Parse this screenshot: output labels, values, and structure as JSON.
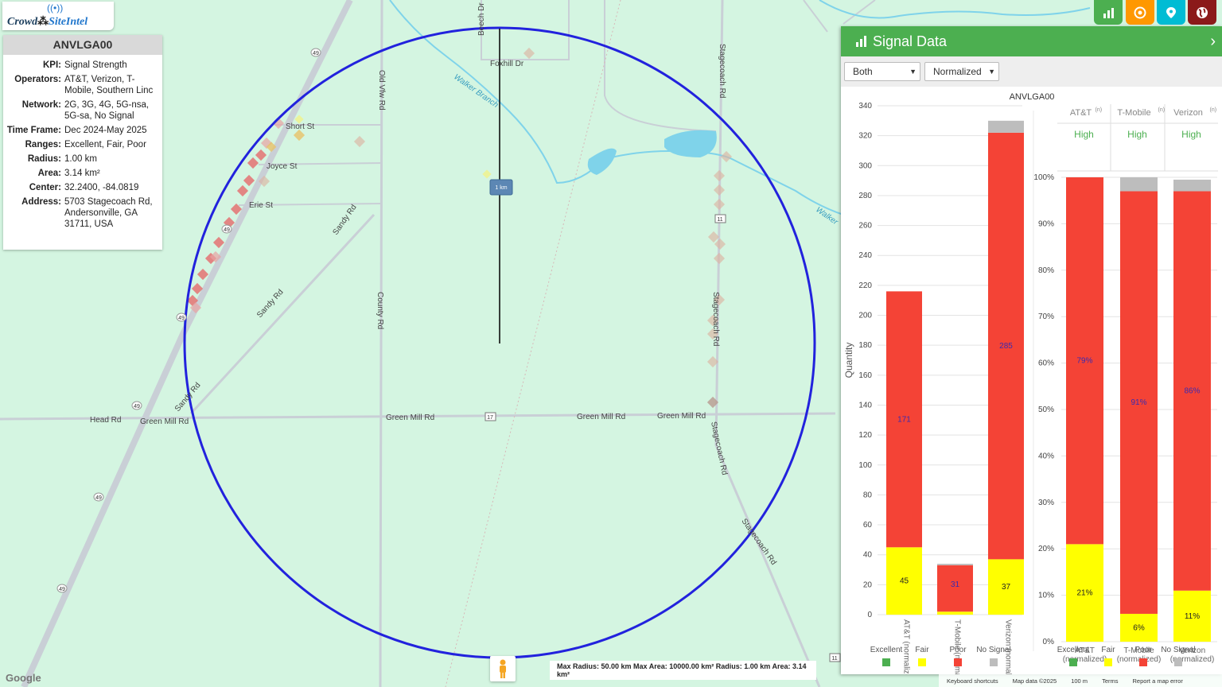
{
  "logo": {
    "part1": "Crowd",
    "part2": "SiteIntel"
  },
  "info": {
    "title": "ANVLGA00",
    "rows": [
      {
        "k": "KPI:",
        "v": "Signal Strength"
      },
      {
        "k": "Operators:",
        "v": "AT&T, Verizon, T-Mobile, Southern Linc"
      },
      {
        "k": "Network:",
        "v": "2G, 3G, 4G, 5G-nsa, 5G-sa, No Signal"
      },
      {
        "k": "Time Frame:",
        "v": "Dec 2024-May 2025"
      },
      {
        "k": "Ranges:",
        "v": "Excellent, Fair, Poor"
      },
      {
        "k": "Radius:",
        "v": "1.00 km"
      },
      {
        "k": "Area:",
        "v": "3.14 km²"
      },
      {
        "k": "Center:",
        "v": "32.2400, -84.0819"
      },
      {
        "k": "Address:",
        "v": "5703 Stagecoach Rd, Andersonville, GA 31711, USA"
      }
    ]
  },
  "toolbar": {
    "buttons": [
      {
        "icon": "bar-chart-icon",
        "color": "#4caf50"
      },
      {
        "icon": "target-icon",
        "color": "#ff9800"
      },
      {
        "icon": "map-pin-icon",
        "color": "#00bcd4"
      },
      {
        "icon": "globe-icon",
        "color": "#8b1a1a"
      }
    ]
  },
  "map": {
    "scale_label": "1 km",
    "road_labels": [
      "Beech Dr",
      "Foxhill Dr",
      "Walker Branch",
      "Old Vfw Rd",
      "Stagecoach Rd",
      "Short St",
      "Joyce St",
      "Erie St",
      "Sandy Rd",
      "County Rd",
      "Head Rd",
      "Green Mill Rd",
      "Walker"
    ],
    "shields": [
      "49",
      "11",
      "17"
    ]
  },
  "panel": {
    "title": "Signal Data",
    "select1": "Both",
    "select2": "Normalized",
    "chart_title": "ANVLGA00"
  },
  "chart_data": [
    {
      "type": "bar",
      "title": "ANVLGA00",
      "ylabel": "Quantity",
      "ylim": [
        0,
        340
      ],
      "yticks": [
        0,
        20,
        40,
        60,
        80,
        100,
        120,
        140,
        160,
        180,
        200,
        220,
        240,
        260,
        280,
        300,
        320,
        340
      ],
      "categories": [
        "AT&T (normalized)",
        "T-Mobile (normalized)",
        "Verizon (normalized)"
      ],
      "series": [
        {
          "name": "Excellent",
          "color": "#4caf50",
          "values": [
            0,
            0,
            0
          ]
        },
        {
          "name": "Fair",
          "color": "#ffff00",
          "values": [
            45,
            2,
            37
          ]
        },
        {
          "name": "Poor",
          "color": "#f44336",
          "values": [
            171,
            31,
            285
          ]
        },
        {
          "name": "No Signal",
          "color": "#bdbdbd",
          "values": [
            0,
            1,
            8
          ]
        }
      ],
      "value_labels": {
        "Fair": [
          "45",
          "2",
          "37"
        ],
        "Poor": [
          "171",
          "31",
          "285"
        ]
      },
      "legend": "bottom"
    },
    {
      "type": "bar",
      "stacked_percent": true,
      "ylim": [
        0,
        100
      ],
      "yticks": [
        "0%",
        "10%",
        "20%",
        "30%",
        "40%",
        "50%",
        "60%",
        "70%",
        "80%",
        "90%",
        "100%"
      ],
      "columns": [
        {
          "header": "AT&T",
          "sup": "(n)",
          "rating": "High"
        },
        {
          "header": "T-Mobile",
          "sup": "(n)",
          "rating": "High"
        },
        {
          "header": "Verizon",
          "sup": "(n)",
          "rating": "High"
        }
      ],
      "categories": [
        "AT&T (normalized)",
        "T-Mobile (normalized)",
        "Verizon (normalized)"
      ],
      "series": [
        {
          "name": "Excellent",
          "color": "#4caf50",
          "values": [
            0,
            0,
            0
          ]
        },
        {
          "name": "Fair",
          "color": "#ffff00",
          "values": [
            21,
            6,
            11
          ]
        },
        {
          "name": "Poor",
          "color": "#f44336",
          "values": [
            79,
            91,
            86
          ]
        },
        {
          "name": "No Signal",
          "color": "#bdbdbd",
          "values": [
            0,
            3,
            2.5
          ]
        }
      ],
      "value_labels": {
        "Fair": [
          "21%",
          "6%",
          "11%"
        ],
        "Poor": [
          "79%",
          "91%",
          "86%"
        ]
      },
      "legend": "bottom"
    }
  ],
  "footer": {
    "stats": "Max Radius: 50.00 km Max Area: 10000.00 km² Radius: 1.00 km Area: 3.14 km²",
    "google": "Google",
    "attribution": [
      "Keyboard shortcuts",
      "Map data ©2025",
      "100 m",
      "Terms",
      "Report a map error"
    ]
  }
}
